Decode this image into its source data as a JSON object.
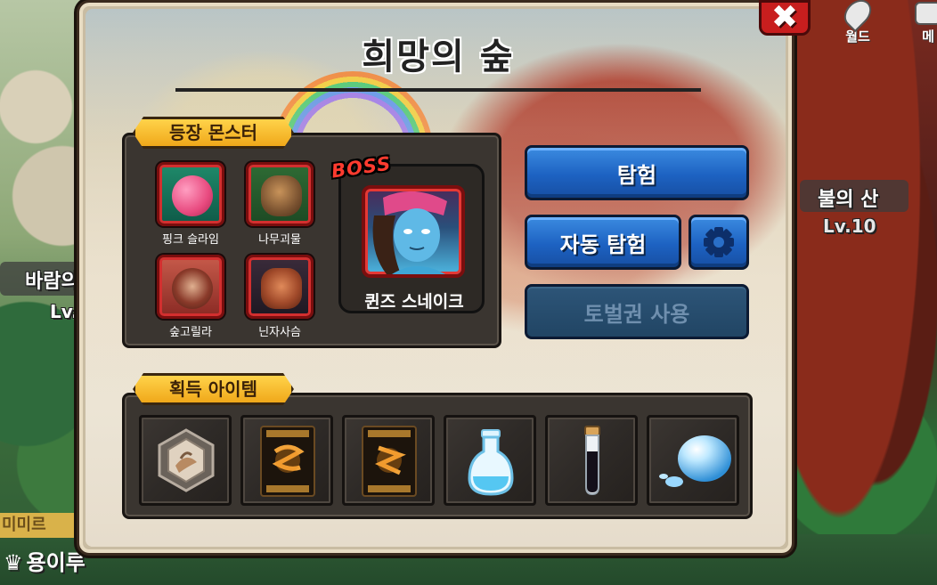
{
  "map": {
    "top_icons": [
      {
        "label": "월드",
        "icon": "map-pin-icon"
      },
      {
        "label": "메",
        "icon": "menu-icon"
      }
    ],
    "left_area_name": "바람의",
    "left_area_level": "Lv.",
    "right_area_name": "불의 산",
    "right_area_level": "Lv.10",
    "bottom_left_tag": "미미르",
    "player_name": "용이루"
  },
  "dialog": {
    "title": "희망의 숲",
    "close_icon": "close-icon",
    "monsters_section": {
      "label": "등장 몬스터",
      "monsters": [
        {
          "name": "핑크 슬라임",
          "color": "#e84a7f"
        },
        {
          "name": "나무괴물",
          "color": "#3f7b2e"
        },
        {
          "name": "숲고릴라",
          "color": "#8a3a2a"
        },
        {
          "name": "닌자사슴",
          "color": "#a14a2a"
        }
      ],
      "boss": {
        "tag": "BOSS",
        "name": "퀸즈 스네이크"
      }
    },
    "actions": {
      "explore": "탐험",
      "auto_explore": "자동 탐험",
      "settings_icon": "gear-icon",
      "use_ticket": "토벌권 사용"
    },
    "items_section": {
      "label": "획득 아이템",
      "items": [
        {
          "icon": "emblem-badge-icon"
        },
        {
          "icon": "card-icon"
        },
        {
          "icon": "card-icon"
        },
        {
          "icon": "flask-icon"
        },
        {
          "icon": "vial-icon"
        },
        {
          "icon": "water-drop-icon"
        }
      ]
    }
  }
}
